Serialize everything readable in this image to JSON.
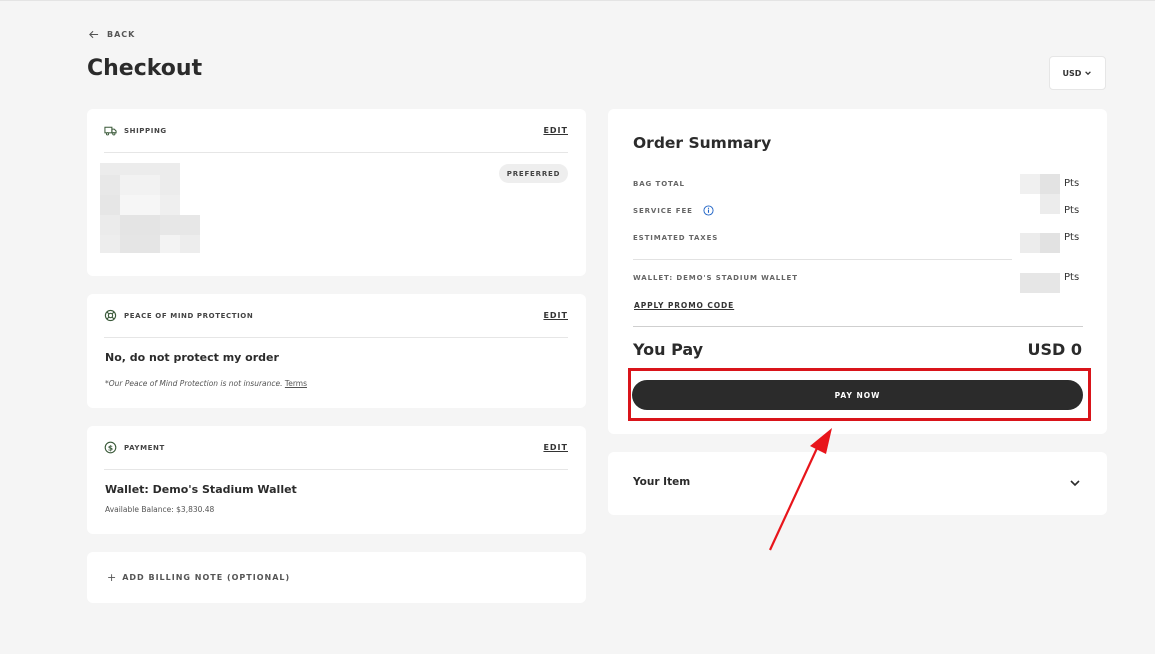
{
  "header": {
    "back_label": "BACK",
    "title": "Checkout",
    "currency": "USD"
  },
  "shipping": {
    "title": "SHIPPING",
    "edit_label": "EDIT",
    "badge": "PREFERRED"
  },
  "protection": {
    "title": "PEACE OF MIND PROTECTION",
    "edit_label": "EDIT",
    "selection": "No, do not protect my order",
    "note": "*Our Peace of Mind Protection is not insurance.",
    "terms_link": "Terms"
  },
  "payment": {
    "title": "PAYMENT",
    "edit_label": "EDIT",
    "method": "Wallet: Demo's Stadium Wallet",
    "balance": "Available Balance: $3,830.48"
  },
  "billing_note": {
    "label": "ADD BILLING NOTE (OPTIONAL)"
  },
  "summary": {
    "title": "Order Summary",
    "lines": [
      {
        "label": "BAG TOTAL",
        "unit": "Pts"
      },
      {
        "label": "SERVICE FEE",
        "unit": "Pts"
      },
      {
        "label": "ESTIMATED TAXES",
        "unit": "Pts"
      },
      {
        "label": "WALLET: DEMO'S STADIUM WALLET",
        "unit": "Pts"
      }
    ],
    "promo_label": "APPLY PROMO CODE",
    "you_pay_label": "You Pay",
    "total": "USD 0",
    "pay_button": "PAY NOW"
  },
  "items": {
    "title": "Your Item"
  },
  "colors": {
    "accent_dark": "#2b2b2b",
    "highlight_red": "#d9141a",
    "icon_green": "#3b5a3a"
  }
}
